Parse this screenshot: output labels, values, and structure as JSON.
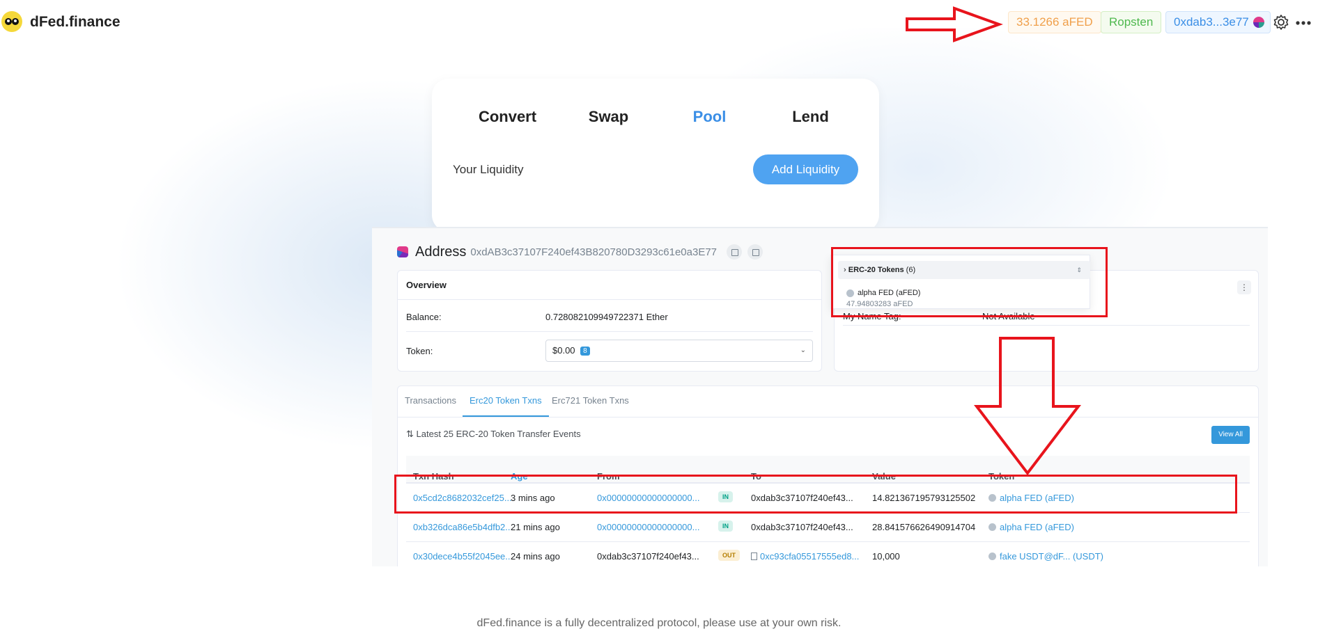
{
  "app": {
    "brand": "dFed.finance",
    "balance_chip": "33.1266 aFED",
    "network_chip": "Ropsten",
    "address_chip": "0xdab3...3e77",
    "icons": {
      "logo": "dfed-logo-icon",
      "settings": "gear-icon",
      "more": "more-dots-icon"
    }
  },
  "card": {
    "tabs": [
      {
        "label": "Convert",
        "active": false
      },
      {
        "label": "Swap",
        "active": false
      },
      {
        "label": "Pool",
        "active": true
      },
      {
        "label": "Lend",
        "active": false
      }
    ],
    "your_liquidity_label": "Your Liquidity",
    "add_liquidity_label": "Add Liquidity"
  },
  "etherscan": {
    "address_title": "Address",
    "address_hash": "0xdAB3c37107F240ef43B820780D3293c61e0a3E77",
    "overview": {
      "title": "Overview",
      "balance_label": "Balance:",
      "balance_value": "0.728082109949722371 Ether",
      "token_label": "Token:",
      "token_value": "$0.00",
      "token_count": "8"
    },
    "more_info": {
      "nametag_label": "My Name Tag:",
      "nametag_value": "Not Available"
    },
    "erc20_dropdown": {
      "header": "ERC-20 Tokens",
      "header_count": "(6)",
      "token_name": "alpha FED (aFED)",
      "token_amount": "47.94803283 aFED"
    },
    "txn_tabs": [
      "Transactions",
      "Erc20 Token Txns",
      "Erc721 Token Txns"
    ],
    "active_txn_tab": "Erc20 Token Txns",
    "latest_caption": "Latest 25 ERC-20 Token Transfer Events",
    "view_all_label": "View All",
    "columns": [
      "Txn Hash",
      "Age",
      "From",
      "To",
      "Value",
      "Token"
    ],
    "rows": [
      {
        "hash": "0x5cd2c8682032cef25...",
        "age": "3 mins ago",
        "from": "0x00000000000000000...",
        "dir": "IN",
        "to": "0xdab3c37107f240ef43...",
        "value": "14.821367195793125502",
        "token": "alpha FED (aFED)"
      },
      {
        "hash": "0xb326dca86e5b4dfb2...",
        "age": "21 mins ago",
        "from": "0x00000000000000000...",
        "dir": "IN",
        "to": "0xdab3c37107f240ef43...",
        "value": "28.841576626490914704",
        "token": "alpha FED (aFED)"
      },
      {
        "hash": "0x30dece4b55f2045ee...",
        "age": "24 mins ago",
        "from": "0xdab3c37107f240ef43...",
        "dir": "OUT",
        "to": "0xc93cfa05517555ed8...",
        "value": "10,000",
        "token": "fake USDT@dF... (USDT)"
      }
    ]
  },
  "footer": "dFed.finance is a fully decentralized protocol, please use at your own risk.",
  "colors": {
    "accent": "#3a8ee6",
    "balance": "#f0a04b",
    "network": "#4fb94f",
    "annotation": "#e8141c",
    "etherscan_blue": "#3498db"
  }
}
